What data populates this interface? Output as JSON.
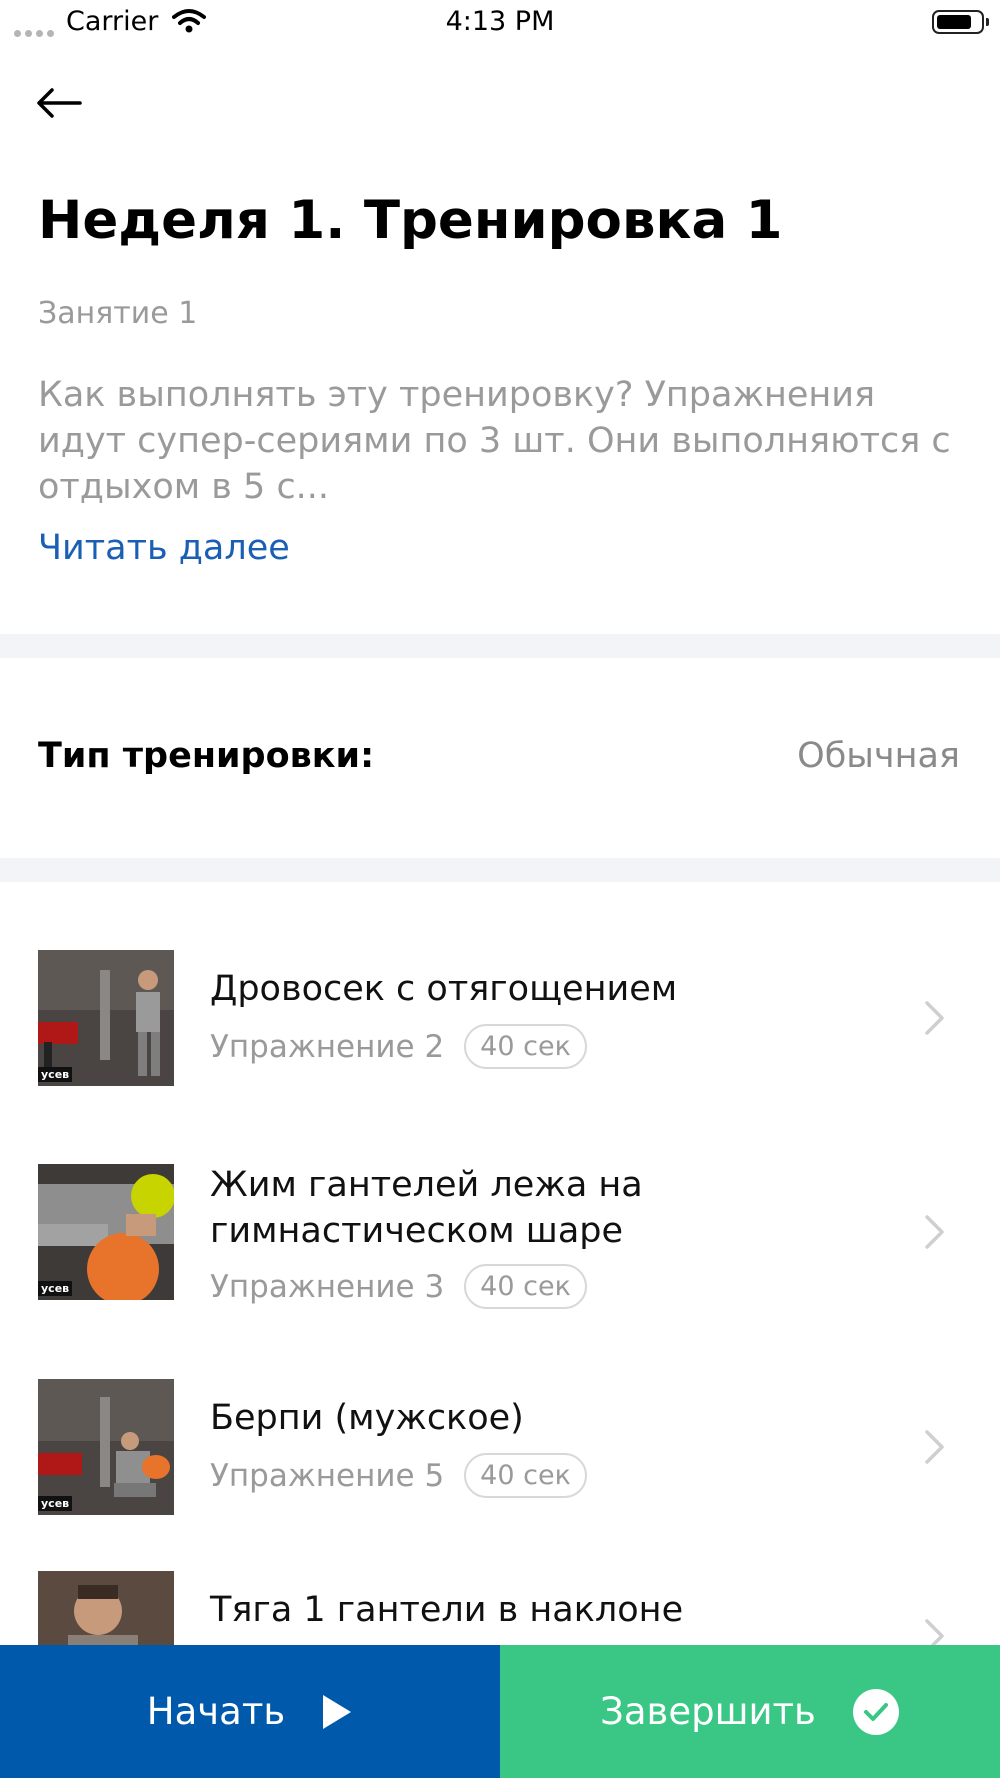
{
  "status_bar": {
    "carrier": "Carrier",
    "time": "4:13 PM"
  },
  "header": {
    "back_icon": "arrow-left-icon",
    "title": "Неделя 1. Тренировка 1",
    "subtitle": "Занятие 1",
    "description": "Как выполнять эту тренировку? Упражнения идут супер-сериями по 3 шт. Они выполняются с отдыхом в 5 с...",
    "read_more": "Читать далее"
  },
  "workout_type": {
    "label": "Тип тренировки:",
    "value": "Обычная"
  },
  "exercises": [
    {
      "name": "Дровосек с отягощением",
      "number": "Упражнение 2",
      "duration": "40 сек",
      "thumb_tag": "усев"
    },
    {
      "name": "Жим гантелей лежа на гимнастическом шаре",
      "number": "Упражнение 3",
      "duration": "40 сек",
      "thumb_tag": "усев"
    },
    {
      "name": "Берпи (мужское)",
      "number": "Упражнение 5",
      "duration": "40 сек",
      "thumb_tag": "усев"
    },
    {
      "name": "Тяга 1 гантели в наклоне"
    }
  ],
  "actions": {
    "start_label": "Начать",
    "start_icon": "play-icon",
    "finish_label": "Завершить",
    "finish_icon": "check-circle-icon"
  },
  "colors": {
    "accent_blue": "#0059ab",
    "accent_green": "#3ac785",
    "link_blue": "#1a5fb4",
    "muted_text": "#9a9a9a",
    "separator": "#f2f4f7"
  }
}
